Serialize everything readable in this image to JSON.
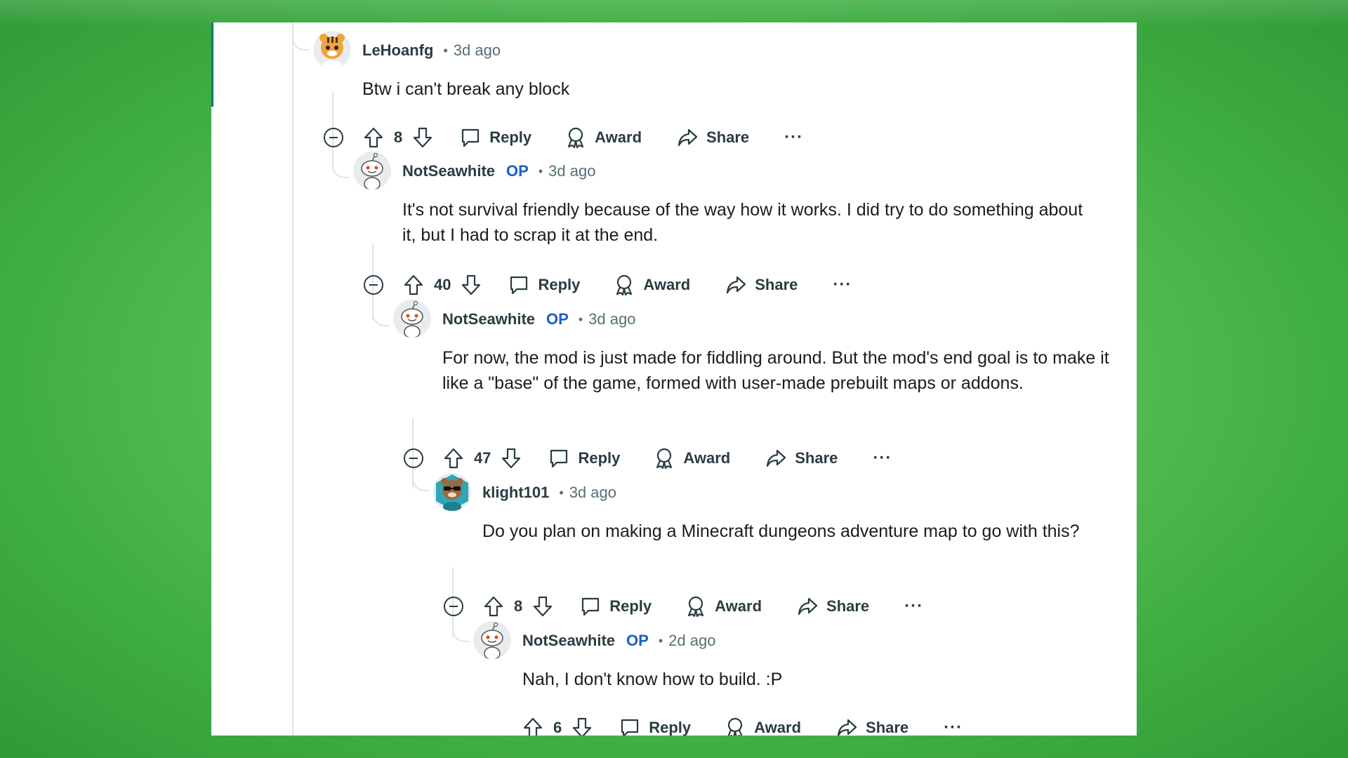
{
  "comments": [
    {
      "author": "LeHoanfg",
      "op_tag": "",
      "time": "3d ago",
      "text": "Btw i can't break any block",
      "votes": "8",
      "avatar_icon": "tiger-avatar-icon"
    },
    {
      "author": "NotSeawhite",
      "op_tag": "OP",
      "time": "3d ago",
      "text": "It's not survival friendly because of the way how it works. I did try to do something about it, but I had to scrap it at the end.",
      "votes": "40",
      "avatar_icon": "snoo-avatar-icon"
    },
    {
      "author": "NotSeawhite",
      "op_tag": "OP",
      "time": "3d ago",
      "text": "For now, the mod is just made for fiddling around. But the mod's end goal is to make it like a \"base\" of the game, formed with user-made prebuilt maps or addons.",
      "votes": "47",
      "avatar_icon": "snoo-avatar-icon"
    },
    {
      "author": "klight101",
      "op_tag": "",
      "time": "3d ago",
      "text": "Do you plan on making a Minecraft dungeons adventure map to go with this?",
      "votes": "8",
      "avatar_icon": "sunglasses-avatar-icon"
    },
    {
      "author": "NotSeawhite",
      "op_tag": "OP",
      "time": "2d ago",
      "text": "Nah, I don't know how to build. :P",
      "votes": "6",
      "avatar_icon": "snoo-avatar-icon"
    }
  ],
  "actions": {
    "reply": "Reply",
    "award": "Award",
    "share": "Share",
    "more": "···"
  },
  "colors": {
    "op": "#1a5ec4",
    "thread_line": "#e1e4e6",
    "background": "#5cc25a"
  }
}
